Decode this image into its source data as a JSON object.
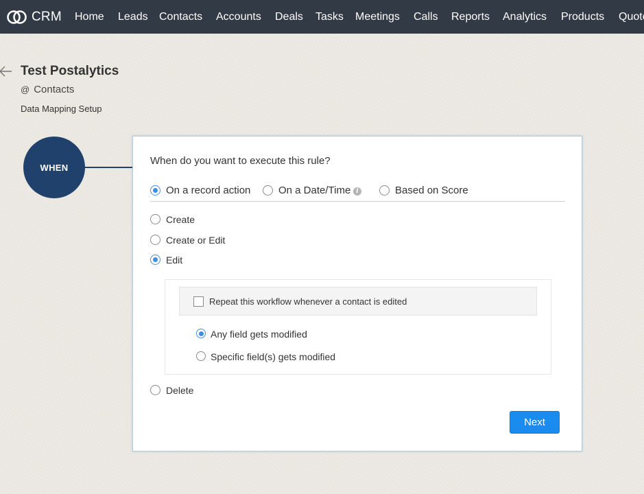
{
  "nav": {
    "brand": "CRM",
    "items": [
      "Home",
      "Leads",
      "Contacts",
      "Accounts",
      "Deals",
      "Tasks",
      "Meetings",
      "Calls",
      "Reports",
      "Analytics",
      "Products",
      "Quotes"
    ]
  },
  "header": {
    "title": "Test Postalytics",
    "module_prefix": "@",
    "module": "Contacts",
    "subtitle": "Data Mapping Setup"
  },
  "step": {
    "label": "WHEN"
  },
  "rule": {
    "question": "When do you want to execute this rule?",
    "trigger_types": [
      {
        "label": "On a record action",
        "selected": true
      },
      {
        "label": "On a Date/Time",
        "selected": false,
        "info_icon": "info-icon"
      },
      {
        "label": "Based on Score",
        "selected": false
      }
    ],
    "actions": [
      {
        "label": "Create",
        "selected": false
      },
      {
        "label": "Create or Edit",
        "selected": false
      },
      {
        "label": "Edit",
        "selected": true
      },
      {
        "label": "Delete",
        "selected": false
      }
    ],
    "edit_options": {
      "repeat_label": "Repeat this workflow whenever a contact is edited",
      "repeat_checked": false,
      "modifiers": [
        {
          "label": "Any field gets modified",
          "selected": true
        },
        {
          "label": "Specific field(s) gets modified",
          "selected": false
        }
      ]
    },
    "next_label": "Next"
  },
  "colors": {
    "nav_bg": "#323a45",
    "step_circle": "#1f416b",
    "primary_button": "#1a8cf0",
    "radio_selected": "#3d8ee6"
  }
}
